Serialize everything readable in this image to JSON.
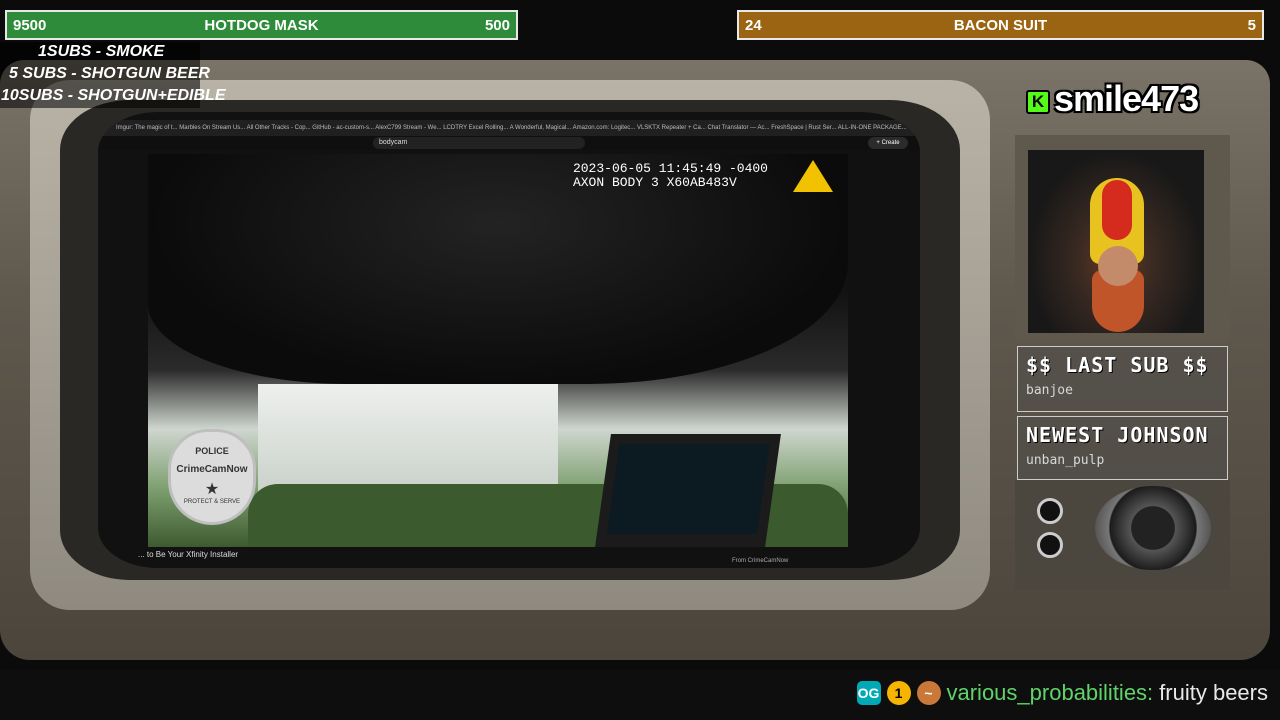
{
  "goals": {
    "left": {
      "current": "9500",
      "title": "HOTDOG MASK",
      "target": "500",
      "color": "#2e8b3a"
    },
    "right": {
      "current": "24",
      "title": "BACON SUIT",
      "target": "5",
      "color": "#9a6412"
    }
  },
  "sub_rules": [
    "1SUBS   - SMOKE",
    "5 SUBS  - SHOTGUN BEER",
    "10SUBS - SHOTGUN+EDIBLE"
  ],
  "browser": {
    "tabs_text": "Imgur: The magic of t...   Marbles On Stream Us...   All Other Tracks - Cop...   GitHub - ac-custom-s...   AlexC799 Stream - We...   LCDTRY Excel Rolling...   A Wonderful, Magical...   Amazon.com: Logitec...   VLSKTX Repeater + Ca...   Chat Translator — Ac...   FreshSpace | Rust Ser...   ALL-IN-ONE PACKAGE...   Club.com   The Vault: Aggressive...",
    "search_value": "bodycam",
    "create_label": "+ Create"
  },
  "video": {
    "timestamp_line1": "2023-06-05 11:45:49 -0400",
    "timestamp_line2": "AXON BODY 3 X60AB483V",
    "badge_top": "POLICE",
    "badge_name": "CrimeCamNow",
    "badge_bottom": "PROTECT & SERVE",
    "caption": "... to Be Your Xfinity Installer",
    "from_label": "From CrimeCamNow"
  },
  "streamer": {
    "name": "smile473",
    "platform_icon": "kick-icon",
    "platform_color": "#53fc18"
  },
  "panels": {
    "last_sub": {
      "title": "$$ LAST SUB $$",
      "value": "banjoe"
    },
    "newest": {
      "title": "NEWEST JOHNSON",
      "value": "unban_pulp"
    }
  },
  "chat": {
    "badges": [
      "og-badge",
      "sub-badge-1",
      "hotdog-badge"
    ],
    "badge_sub_text": "1",
    "user": "various_probabilities:",
    "message": "fruity beers",
    "user_color": "#5fd36a"
  }
}
